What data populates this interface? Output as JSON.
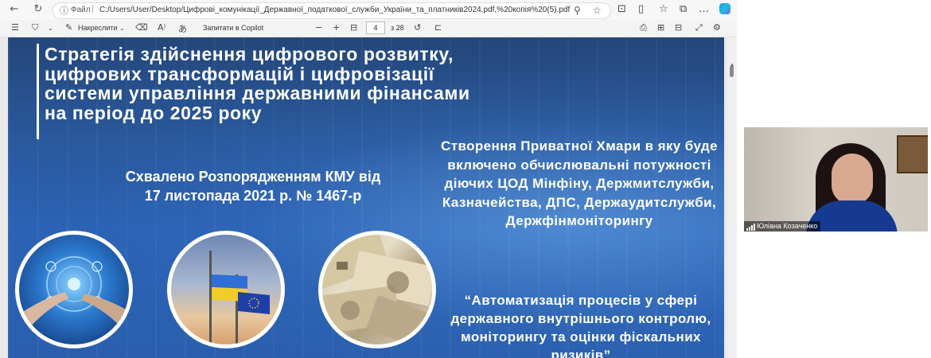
{
  "browser": {
    "url_scheme_label": "Файл",
    "url": "C:/Users/User/Desktop/Цифрові_комунікації_Державної_податкової_служби_України_та_платників2024.pdf,%20копія%20(5).pdf"
  },
  "pdf_toolbar": {
    "draw_label": "Накреслити",
    "copilot_label": "Запитати в Copilot",
    "page_current": "4",
    "page_total": "з 28"
  },
  "slide": {
    "title": "Стратегія здійснення цифрового розвитку, цифрових трансформацій і цифровізації системи управління державними фінансами на період до 2025 року",
    "approved": "Схвалено Розпорядженням КМУ від 17 листопада 2021 р. № 1467-р",
    "cloud": "Створення Приватної Хмари в яку буде включено обчислювальні потужності діючих ЦОД Мінфіну, Держмитслужби, Казначейства, ДПС, Держаудитслужби, Держфінмоніторингу",
    "automation": "“Автоматизація процесів у сфері державного внутрішнього контролю, моніторингу та оцінки фіскальних ризиків”"
  },
  "video": {
    "participant_name": "Юліана Козаченко"
  },
  "colors": {
    "slide_blue": "#2a5aa0",
    "flag_blue": "#2f6fd6",
    "flag_yellow": "#f2cc2a",
    "eu_blue": "#1f3fa8"
  }
}
